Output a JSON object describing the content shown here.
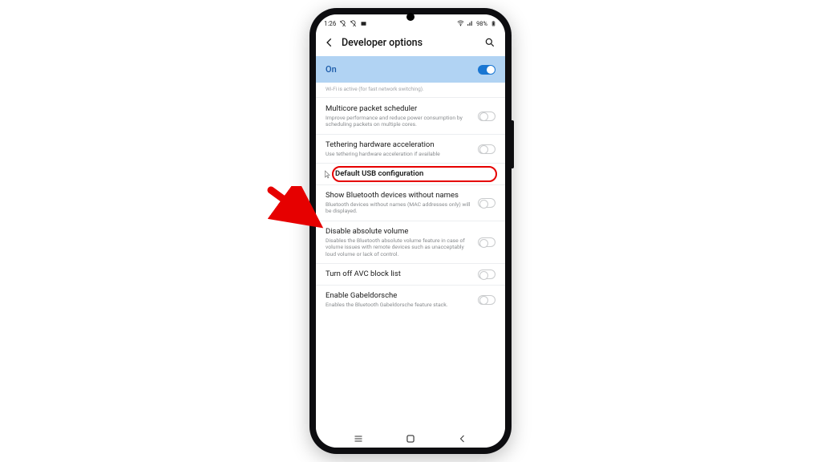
{
  "status": {
    "time": "1:26",
    "battery_pct": "98%"
  },
  "header": {
    "title": "Developer options"
  },
  "banner": {
    "label": "On"
  },
  "fade_text": "Wi-Fi is active (for fast network switching).",
  "rows": {
    "multicore": {
      "title": "Multicore packet scheduler",
      "sub": "Improve performance and reduce power consumption by scheduling packets on multiple cores."
    },
    "tether": {
      "title": "Tethering hardware acceleration",
      "sub": "Use tethering hardware acceleration if available"
    },
    "usb": {
      "title": "Default USB configuration"
    },
    "bt_noname": {
      "title": "Show Bluetooth devices without names",
      "sub": "Bluetooth devices without names (MAC addresses only) will be displayed."
    },
    "abs_vol": {
      "title": "Disable absolute volume",
      "sub": "Disables the Bluetooth absolute volume feature in case of volume issues with remote devices such as unacceptably loud volume or lack of control."
    },
    "avc": {
      "title": "Turn off AVC block list"
    },
    "gabel": {
      "title": "Enable Gabeldorsche",
      "sub": "Enables the Bluetooth Gabeldorsche feature stack."
    }
  }
}
